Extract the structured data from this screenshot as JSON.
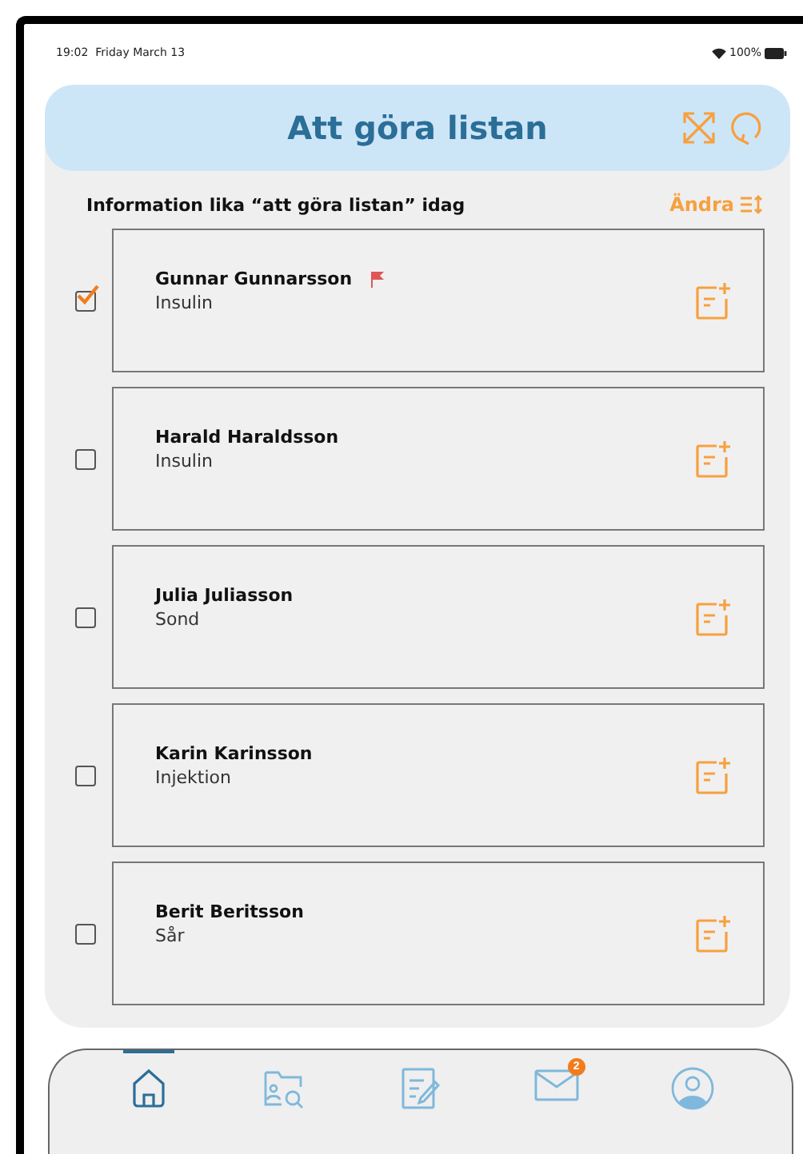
{
  "status_bar": {
    "time": "19:02",
    "date": "Friday March 13",
    "battery": "100%"
  },
  "header": {
    "title": "Att göra listan"
  },
  "section": {
    "title": "Information lika “att göra listan” idag",
    "edit_label": "Ändra"
  },
  "tasks": [
    {
      "name": "Gunnar Gunnarsson",
      "task": "Insulin",
      "checked": true,
      "flagged": true
    },
    {
      "name": "Harald Haraldsson",
      "task": "Insulin",
      "checked": false,
      "flagged": false
    },
    {
      "name": "Julia Juliasson",
      "task": "Sond",
      "checked": false,
      "flagged": false
    },
    {
      "name": "Karin Karinsson",
      "task": "Injektion",
      "checked": false,
      "flagged": false
    },
    {
      "name": "Berit Beritsson",
      "task": "Sår",
      "checked": false,
      "flagged": false
    }
  ],
  "tab_bar": [
    {
      "kind": "home",
      "selected": true
    },
    {
      "kind": "patients",
      "selected": false
    },
    {
      "kind": "notes",
      "selected": false
    },
    {
      "kind": "messages",
      "selected": false,
      "badge": "2"
    },
    {
      "kind": "profile",
      "selected": false
    }
  ]
}
